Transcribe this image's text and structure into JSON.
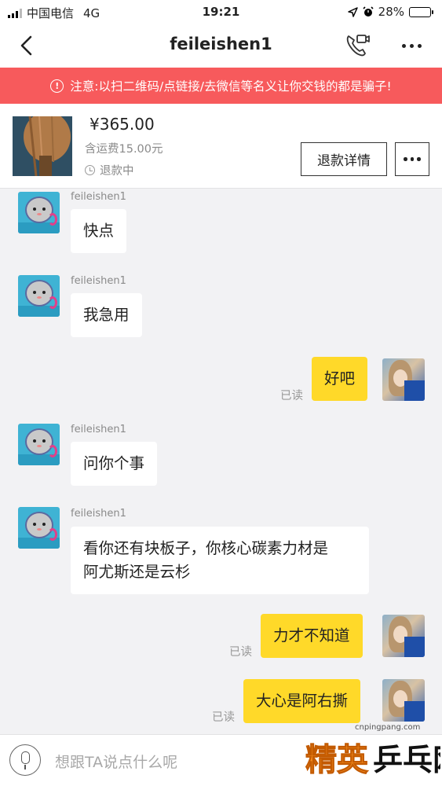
{
  "status_bar": {
    "carrier": "中国电信",
    "network": "4G",
    "time": "19:21",
    "battery_text": "28%",
    "battery_level": 0.28
  },
  "nav": {
    "title": "feileishen1"
  },
  "warning": {
    "text": "注意:以扫二维码/点链接/去微信等名义让你交钱的都是骗子!"
  },
  "product": {
    "price": "¥365.00",
    "shipping": "含运费15.00元",
    "status": "退款中",
    "refund_button": "退款详情"
  },
  "messages": [
    {
      "side": "left",
      "sender": "feileishen1",
      "text": "快点"
    },
    {
      "side": "left",
      "sender": "feileishen1",
      "text": "我急用"
    },
    {
      "side": "right",
      "text": "好吧",
      "read": "已读"
    },
    {
      "side": "left",
      "sender": "feileishen1",
      "text": "问你个事"
    },
    {
      "side": "left",
      "sender": "feileishen1",
      "text": "看你还有块板子，你核心碳素力材是\n阿尤斯还是云杉"
    },
    {
      "side": "right",
      "text": "力才不知道",
      "read": "已读"
    },
    {
      "side": "right",
      "text": "大心是阿右撕",
      "read": "已读"
    }
  ],
  "input": {
    "placeholder": "想跟TA说点什么呢"
  },
  "watermark": {
    "url": "cnpingpang.com",
    "logo": "精英乒乓网"
  },
  "colors": {
    "warning_bg": "#f75a5c",
    "my_bubble": "#ffd929",
    "their_bubble": "#ffffff",
    "chat_bg": "#f2f2f4"
  }
}
